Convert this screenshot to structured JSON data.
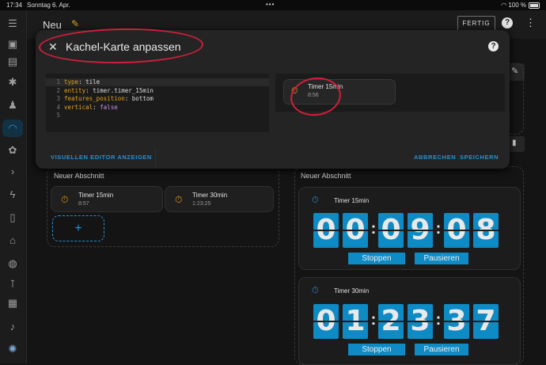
{
  "status": {
    "time": "17:34",
    "date": "Sonntag 6. Apr.",
    "battery": "100 %"
  },
  "sidebar": {
    "icons": [
      "menu-icon",
      "person-card-icon",
      "account-box-icon",
      "hub-icon",
      "person-wrench-icon",
      "gauge-icon",
      "flower-icon",
      "chevron-right-icon",
      "lightning-icon",
      "remote-icon",
      "home-network-icon",
      "globe-icon",
      "thermometer-icon",
      "dashboard-icon",
      "bell-icon",
      "avatar-icon"
    ]
  },
  "topbar": {
    "title": "Neu",
    "done": "FERTIG",
    "help": "?"
  },
  "sections": {
    "left": {
      "title": "Neuer Abschnitt",
      "tiles": [
        {
          "name": "Timer 15min",
          "value": "8:57"
        },
        {
          "name": "Timer 30min",
          "value": "1:23:25"
        }
      ],
      "add": "+"
    },
    "right": {
      "title": "Neuer Abschnitt"
    }
  },
  "cards": [
    {
      "name": "Timer 15min",
      "digits": [
        "0",
        "0",
        "0",
        "9",
        "0",
        "8"
      ],
      "stop": "Stoppen",
      "pause": "Pausieren"
    },
    {
      "name": "Timer 30min",
      "digits": [
        "0",
        "1",
        "2",
        "3",
        "3",
        "7"
      ],
      "stop": "Stoppen",
      "pause": "Pausieren"
    }
  ],
  "dialog": {
    "title": "Kachel-Karte anpassen",
    "line_numbers": "1\n2\n3\n4\n5",
    "code": [
      {
        "key": "type",
        "value": "tile"
      },
      {
        "key": "entity",
        "value": "timer.timer_15min"
      },
      {
        "key": "features_position",
        "value": "bottom"
      },
      {
        "key": "vertical",
        "value": "false"
      }
    ],
    "preview": {
      "name": "Timer 15min",
      "value": "8:56"
    },
    "visual_editor": "VISUELLEN EDITOR ANZEIGEN",
    "cancel": "ABBRECHEN",
    "save": "SPEICHERN"
  },
  "colors": {
    "accent": "#0e8ac4",
    "timer_icon": "#e0a21c",
    "annotation": "#d11f3b"
  }
}
